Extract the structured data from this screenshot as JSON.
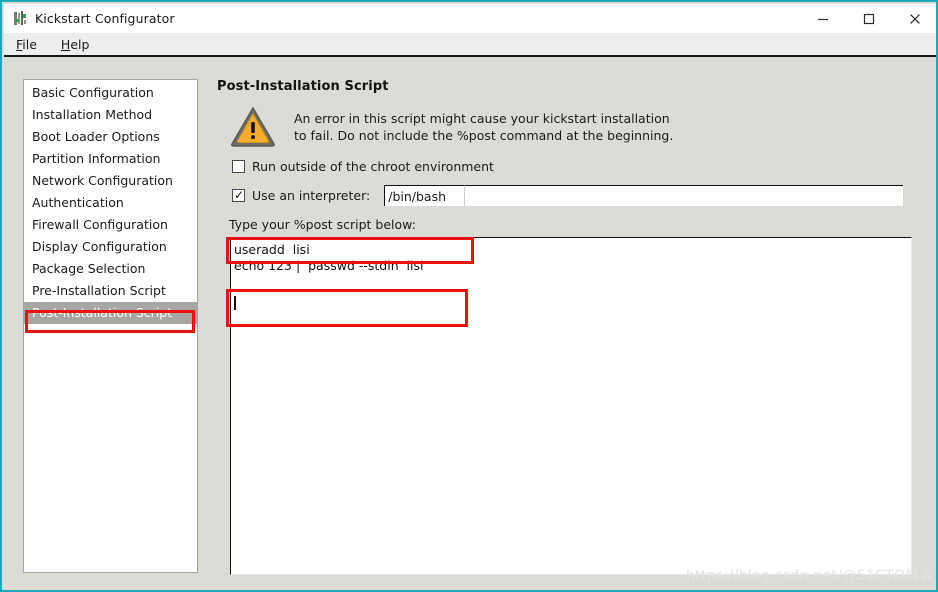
{
  "window": {
    "title": "Kickstart Configurator",
    "icon": "kickstart-app-icon",
    "controls": {
      "minimize": "minimize-icon",
      "maximize": "maximize-icon",
      "close": "close-icon"
    }
  },
  "menubar": {
    "items": [
      {
        "label": "File",
        "mnemonic": "F",
        "rest": "ile"
      },
      {
        "label": "Help",
        "mnemonic": "H",
        "rest": "elp"
      }
    ]
  },
  "sidebar": {
    "items": [
      {
        "label": "Basic Configuration",
        "selected": false
      },
      {
        "label": "Installation Method",
        "selected": false
      },
      {
        "label": "Boot Loader Options",
        "selected": false
      },
      {
        "label": "Partition Information",
        "selected": false
      },
      {
        "label": "Network Configuration",
        "selected": false
      },
      {
        "label": "Authentication",
        "selected": false
      },
      {
        "label": "Firewall Configuration",
        "selected": false
      },
      {
        "label": "Display Configuration",
        "selected": false
      },
      {
        "label": "Package Selection",
        "selected": false
      },
      {
        "label": "Pre-Installation Script",
        "selected": false
      },
      {
        "label": "Post-Installation Script",
        "selected": true
      }
    ]
  },
  "main": {
    "page_title": "Post-Installation Script",
    "warning": {
      "icon": "warning-triangle-icon",
      "line1": "An error in this script might cause your kickstart installation",
      "line2": "to fail. Do not include the %post command at the beginning."
    },
    "chroot_checkbox": {
      "label": "Run outside of the chroot environment",
      "checked": false
    },
    "interpreter_checkbox": {
      "label": "Use an interpreter:",
      "checked": true,
      "tick": "✓",
      "value": "/bin/bash",
      "placeholder": ""
    },
    "script_label": "Type your %post script below:",
    "script_lines": [
      "useradd  lisi",
      "echo 123 |  passwd --stdin  lisi"
    ]
  },
  "annotations": {
    "colors": {
      "highlight": "#ee1111",
      "selection": "#a7a7a2",
      "accent": "#1aa9b5"
    }
  },
  "watermark": {
    "text": "https://blog.csdn.net/@51CTO博客"
  }
}
